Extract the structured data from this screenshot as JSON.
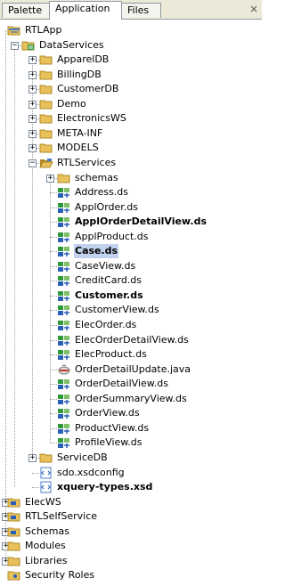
{
  "tabs": [
    {
      "label": "Palette",
      "active": false
    },
    {
      "label": "Application",
      "active": true
    },
    {
      "label": "Files",
      "active": false
    }
  ],
  "close_glyph": "×",
  "tree": [
    {
      "label": "RTLApp",
      "level": 0,
      "icon": "app-folder-icon",
      "expander": "none"
    },
    {
      "label": "DataServices",
      "level": 1,
      "icon": "dataservices-folder-icon",
      "expander": "minus"
    },
    {
      "label": "ApparelDB",
      "level": 2,
      "icon": "folder-icon",
      "expander": "plus"
    },
    {
      "label": "BillingDB",
      "level": 2,
      "icon": "folder-icon",
      "expander": "plus"
    },
    {
      "label": "CustomerDB",
      "level": 2,
      "icon": "folder-icon",
      "expander": "plus"
    },
    {
      "label": "Demo",
      "level": 2,
      "icon": "folder-icon",
      "expander": "plus"
    },
    {
      "label": "ElectronicsWS",
      "level": 2,
      "icon": "folder-icon",
      "expander": "plus"
    },
    {
      "label": "META-INF",
      "level": 2,
      "icon": "folder-icon",
      "expander": "plus"
    },
    {
      "label": "MODELS",
      "level": 2,
      "icon": "folder-icon",
      "expander": "plus"
    },
    {
      "label": "RTLServices",
      "level": 2,
      "icon": "open-folder-icon",
      "expander": "minus"
    },
    {
      "label": "schemas",
      "level": 3,
      "icon": "folder-icon",
      "expander": "plus"
    },
    {
      "label": "Address.ds",
      "level": 3,
      "icon": "data-service-file-icon",
      "expander": "none"
    },
    {
      "label": "ApplOrder.ds",
      "level": 3,
      "icon": "data-service-file-icon",
      "expander": "none"
    },
    {
      "label": "ApplOrderDetailView.ds",
      "level": 3,
      "icon": "data-service-file-icon",
      "expander": "none",
      "bold": true
    },
    {
      "label": "ApplProduct.ds",
      "level": 3,
      "icon": "data-service-file-icon",
      "expander": "none"
    },
    {
      "label": "Case.ds",
      "level": 3,
      "icon": "data-service-file-icon",
      "expander": "none",
      "bold": true,
      "selected": true
    },
    {
      "label": "CaseView.ds",
      "level": 3,
      "icon": "data-service-file-icon",
      "expander": "none"
    },
    {
      "label": "CreditCard.ds",
      "level": 3,
      "icon": "data-service-file-icon",
      "expander": "none"
    },
    {
      "label": "Customer.ds",
      "level": 3,
      "icon": "data-service-file-icon",
      "expander": "none",
      "bold": true
    },
    {
      "label": "CustomerView.ds",
      "level": 3,
      "icon": "data-service-file-icon",
      "expander": "none"
    },
    {
      "label": "ElecOrder.ds",
      "level": 3,
      "icon": "data-service-file-icon",
      "expander": "none"
    },
    {
      "label": "ElecOrderDetailView.ds",
      "level": 3,
      "icon": "data-service-file-icon",
      "expander": "none"
    },
    {
      "label": "ElecProduct.ds",
      "level": 3,
      "icon": "data-service-file-icon",
      "expander": "none"
    },
    {
      "label": "OrderDetailUpdate.java",
      "level": 3,
      "icon": "java-file-icon",
      "expander": "none"
    },
    {
      "label": "OrderDetailView.ds",
      "level": 3,
      "icon": "data-service-file-icon",
      "expander": "none"
    },
    {
      "label": "OrderSummaryView.ds",
      "level": 3,
      "icon": "data-service-file-icon",
      "expander": "none"
    },
    {
      "label": "OrderView.ds",
      "level": 3,
      "icon": "data-service-file-icon",
      "expander": "none"
    },
    {
      "label": "ProductView.ds",
      "level": 3,
      "icon": "data-service-file-icon",
      "expander": "none"
    },
    {
      "label": "ProfileView.ds",
      "level": 3,
      "icon": "data-service-file-icon",
      "expander": "none"
    },
    {
      "label": "ServiceDB",
      "level": 2,
      "icon": "folder-icon",
      "expander": "plus"
    },
    {
      "label": "sdo.xsdconfig",
      "level": 2,
      "icon": "xml-file-icon",
      "expander": "none"
    },
    {
      "label": "xquery-types.xsd",
      "level": 2,
      "icon": "xml-file-icon",
      "expander": "none",
      "bold": true
    },
    {
      "label": "ElecWS",
      "level": 0,
      "icon": "project-folder-icon",
      "expander": "plus"
    },
    {
      "label": "RTLSelfService",
      "level": 0,
      "icon": "project-folder-icon",
      "expander": "plus"
    },
    {
      "label": "Schemas",
      "level": 0,
      "icon": "project-folder-icon",
      "expander": "plus"
    },
    {
      "label": "Modules",
      "level": 0,
      "icon": "folder-icon",
      "expander": "plus"
    },
    {
      "label": "Libraries",
      "level": 0,
      "icon": "folder-icon",
      "expander": "plus"
    },
    {
      "label": "Security Roles",
      "level": 0,
      "icon": "security-roles-icon",
      "expander": "none"
    }
  ],
  "colors": {
    "folder": "#e8c15a",
    "folder_dark": "#b08a2a",
    "selection": "#c1d2ee",
    "ds_green": "#2e9a3a",
    "ds_blue": "#2a5fb8"
  }
}
